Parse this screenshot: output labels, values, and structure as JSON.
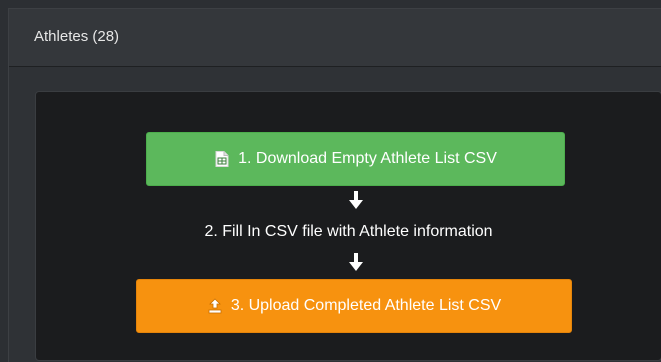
{
  "panel": {
    "title": "Athletes (28)"
  },
  "steps": {
    "download_label": "1. Download Empty Athlete List CSV",
    "fill_label": "2. Fill In CSV file with Athlete information",
    "upload_label": "3. Upload Completed Athlete List CSV"
  },
  "icons": {
    "download": "spreadsheet-icon",
    "upload": "upload-icon",
    "arrow": "arrow-down-icon"
  },
  "colors": {
    "download_button": "#5cb85c",
    "upload_button": "#f7920f",
    "body_background": "#1b1c1e"
  }
}
